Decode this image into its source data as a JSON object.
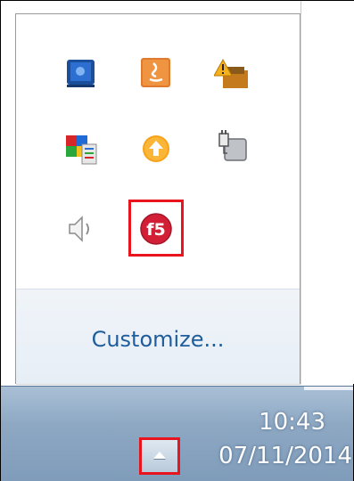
{
  "popup": {
    "customize_label": "Customize...",
    "icons": [
      {
        "name": "network-blue-icon"
      },
      {
        "name": "java-icon"
      },
      {
        "name": "warning-update-icon"
      },
      {
        "name": "color-grid-icon"
      },
      {
        "name": "update-arrow-icon"
      },
      {
        "name": "power-plug-icon"
      },
      {
        "name": "speaker-icon"
      },
      {
        "name": "f5-icon"
      }
    ],
    "highlighted_icon": "f5-icon"
  },
  "taskbar": {
    "time": "10:43",
    "date": "07/11/2014",
    "show_hidden_button_icon": "up-arrow-icon"
  },
  "colors": {
    "highlight": "#e8141e",
    "link": "#1e5d9c",
    "taskbar": "#8ea8c3"
  }
}
